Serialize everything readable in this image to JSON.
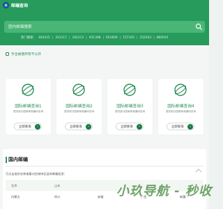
{
  "header": {
    "site_title": "邮编查询",
    "logo_icon": "globe-logo-icon",
    "search": {
      "placeholder": "国内邮编搜索"
    },
    "hot": {
      "label": "热门搜索：",
      "codes": [
        "404315",
        "313117",
        "342213",
        "031308",
        "651609",
        "157103",
        "252033",
        "860025"
      ]
    }
  },
  "notice": {
    "text": "手全被使所有不公开"
  },
  "cards": [
    {
      "title": "国际邮编查询1",
      "desc": "提供部分国家邮政编码查询",
      "button": "立即查询"
    },
    {
      "title": "国际邮编查询2",
      "desc": "提供部分国家邮政编码查询",
      "button": "立即查询"
    },
    {
      "title": "国际邮编查询3",
      "desc": "提供部分国家邮政编码查询",
      "button": "立即查询"
    },
    {
      "title": "国际邮编查询4",
      "desc": "提供部分国家邮政编码查询",
      "button": "立即查询"
    }
  ],
  "section": {
    "title": "国内邮编",
    "desc": "可点击省份名称查看对应城市区县的邮编信息：",
    "rows": [
      [
        "北京",
        "山东",
        "",
        "",
        ""
      ],
      [
        "内蒙古",
        "四川",
        "安徽",
        "广西",
        "新疆"
      ]
    ]
  },
  "watermark": "小玖导航 - 秒收",
  "colors": {
    "brand": "#269b5b",
    "accent_text": "#2a8f57",
    "button_arrow": "#1e7a47"
  }
}
